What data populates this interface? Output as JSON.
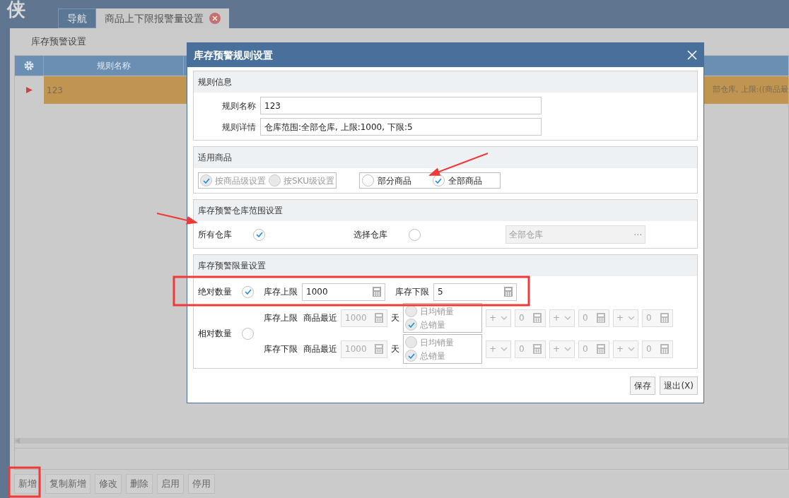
{
  "logo": {
    "text": "侠"
  },
  "tabs": [
    {
      "label": "导航",
      "selected": false,
      "closable": false
    },
    {
      "label": "商品上下限报警量设置",
      "selected": true,
      "closable": true
    }
  ],
  "page_title": "库存预警设置",
  "table": {
    "columns": [
      "规则名称"
    ],
    "rows": [
      {
        "selected": true,
        "cells": [
          "123"
        ],
        "overflow_text": "部仓库, 上限:((商品最"
      }
    ]
  },
  "toolbar": [
    "新增",
    "复制新增",
    "修改",
    "删除",
    "启用",
    "停用"
  ],
  "dialog": {
    "title": "库存预警规则设置",
    "rule_info": {
      "heading": "规则信息",
      "fields": [
        {
          "label": "规则名称",
          "value": "123"
        },
        {
          "label": "规则详情",
          "value": "仓库范围:全部仓库, 上限:1000, 下限:5"
        }
      ]
    },
    "products": {
      "heading": "适用商品",
      "level_options": [
        {
          "label": "按商品级设置",
          "selected": true,
          "disabled": true
        },
        {
          "label": "按SKU级设置",
          "selected": false,
          "disabled": true
        }
      ],
      "scope_options": [
        {
          "label": "部分商品",
          "selected": false,
          "disabled": false
        },
        {
          "label": "全部商品",
          "selected": true,
          "disabled": false
        }
      ]
    },
    "warehouse": {
      "heading": "库存预警仓库范围设置",
      "options": [
        {
          "label": "所有仓库",
          "selected": true
        },
        {
          "label": "选择仓库",
          "selected": false
        }
      ],
      "picker": {
        "value": "全部仓库",
        "button": "⋯",
        "disabled": true
      }
    },
    "limits": {
      "heading": "库存预警限量设置",
      "absolute": {
        "label": "绝对数量",
        "selected": true,
        "upper_label": "库存上限",
        "upper_value": "1000",
        "lower_label": "库存下限",
        "lower_value": "5"
      },
      "relative": {
        "label": "相对数量",
        "selected": false,
        "rows": [
          {
            "label": "库存上限",
            "recent_label": "商品最近",
            "days": "1000",
            "days_unit": "天",
            "options": [
              {
                "label": "日均销量",
                "selected": false
              },
              {
                "label": "总销量",
                "selected": true
              }
            ],
            "terms": [
              {
                "op": "+",
                "value": "0"
              },
              {
                "op": "+",
                "value": "0"
              },
              {
                "op": "+",
                "value": "0"
              }
            ]
          },
          {
            "label": "库存下限",
            "recent_label": "商品最近",
            "days": "1000",
            "days_unit": "天",
            "options": [
              {
                "label": "日均销量",
                "selected": false
              },
              {
                "label": "总销量",
                "selected": true
              }
            ],
            "terms": [
              {
                "op": "+",
                "value": "0"
              },
              {
                "op": "+",
                "value": "0"
              },
              {
                "op": "+",
                "value": "0"
              }
            ]
          }
        ]
      }
    },
    "buttons": [
      "保存",
      "退出(X)"
    ]
  }
}
